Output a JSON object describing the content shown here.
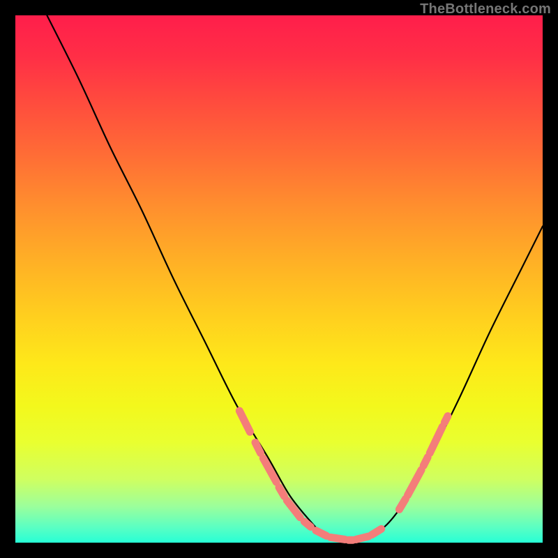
{
  "watermark": "TheBottleneck.com",
  "colors": {
    "background": "#000000",
    "curve": "#000000",
    "highlight": "#F47D7A",
    "gradient_top": "#FF1E4B",
    "gradient_bottom": "#27FFD6"
  },
  "chart_data": {
    "type": "line",
    "title": "",
    "xlabel": "",
    "ylabel": "",
    "xlim": [
      0,
      100
    ],
    "ylim": [
      0,
      100
    ],
    "note": "Axes are unlabeled; values are estimated from pixel positions (0–100 normalized). y=0 is bottom (green), y=100 is top (red).",
    "series": [
      {
        "name": "bottleneck-curve",
        "x": [
          6,
          12,
          18,
          24,
          30,
          36,
          42,
          48,
          52,
          56,
          58,
          60,
          63,
          66,
          70,
          74,
          78,
          84,
          90,
          96,
          100
        ],
        "y": [
          100,
          88,
          75,
          63,
          50,
          38,
          26,
          16,
          9,
          4,
          2,
          1,
          0.5,
          1,
          3,
          8,
          15,
          27,
          40,
          52,
          60
        ]
      }
    ],
    "highlights": {
      "description": "coral dashed segments overlaid on the curve near the valley region",
      "left_branch": [
        {
          "x0": 42.5,
          "y0": 25,
          "x1": 44.5,
          "y1": 21
        },
        {
          "x0": 45.5,
          "y0": 19,
          "x1": 46.5,
          "y1": 17
        },
        {
          "x0": 47.0,
          "y0": 16,
          "x1": 49.5,
          "y1": 11.5
        },
        {
          "x0": 50.0,
          "y0": 10.5,
          "x1": 51.0,
          "y1": 8.8
        },
        {
          "x0": 51.5,
          "y0": 8.0,
          "x1": 54.0,
          "y1": 4.8
        },
        {
          "x0": 54.8,
          "y0": 4.0,
          "x1": 56.0,
          "y1": 3.0
        }
      ],
      "bottom": [
        {
          "x0": 57.0,
          "y0": 2.3,
          "x1": 59.0,
          "y1": 1.3
        },
        {
          "x0": 59.8,
          "y0": 1.0,
          "x1": 62.5,
          "y1": 0.6
        },
        {
          "x0": 63.2,
          "y0": 0.5,
          "x1": 64.0,
          "y1": 0.5
        },
        {
          "x0": 64.6,
          "y0": 0.6,
          "x1": 67.0,
          "y1": 1.2
        },
        {
          "x0": 67.6,
          "y0": 1.5,
          "x1": 69.4,
          "y1": 2.6
        }
      ],
      "right_branch": [
        {
          "x0": 72.8,
          "y0": 6.3,
          "x1": 74.0,
          "y1": 8.3
        },
        {
          "x0": 74.4,
          "y0": 9.0,
          "x1": 77.0,
          "y1": 13.8
        },
        {
          "x0": 77.4,
          "y0": 14.6,
          "x1": 78.2,
          "y1": 16.2
        },
        {
          "x0": 78.6,
          "y0": 17.0,
          "x1": 81.0,
          "y1": 22.0
        },
        {
          "x0": 81.4,
          "y0": 22.8,
          "x1": 82.0,
          "y1": 24.0
        }
      ]
    }
  }
}
